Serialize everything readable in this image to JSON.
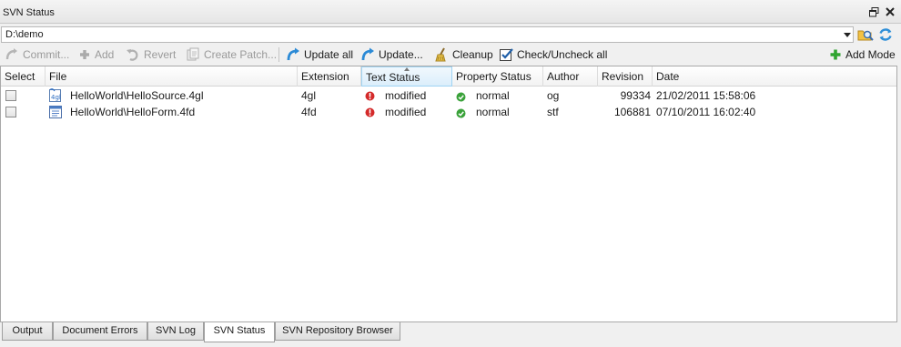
{
  "window": {
    "title": "SVN Status"
  },
  "path": {
    "value": "D:\\demo"
  },
  "toolbar": {
    "commit": "Commit...",
    "add": "Add",
    "revert": "Revert",
    "create_patch": "Create Patch...",
    "update_all": "Update all",
    "update": "Update...",
    "cleanup": "Cleanup",
    "check_uncheck_all": "Check/Uncheck all",
    "add_mode": "Add Mode"
  },
  "table": {
    "columns": {
      "select": "Select",
      "file": "File",
      "extension": "Extension",
      "text_status": "Text Status",
      "property_status": "Property Status",
      "author": "Author",
      "revision": "Revision",
      "date": "Date"
    },
    "rows": [
      {
        "file": "HelloWorld\\HelloSource.4gl",
        "extension": "4gl",
        "text_status": "modified",
        "property_status": "normal",
        "author": "og",
        "revision": "99334",
        "date": "21/02/2011 15:58:06"
      },
      {
        "file": "HelloWorld\\HelloForm.4fd",
        "extension": "4fd",
        "text_status": "modified",
        "property_status": "normal",
        "author": "stf",
        "revision": "106881",
        "date": "07/10/2011 16:02:40"
      }
    ]
  },
  "tabs": [
    "Output",
    "Document Errors",
    "SVN Log",
    "SVN Status",
    "SVN Repository Browser"
  ],
  "active_tab": "SVN Status",
  "colors": {
    "modified": "#d42a2a",
    "normal": "#3aa23a",
    "sorted_header": "#dbeefb"
  }
}
